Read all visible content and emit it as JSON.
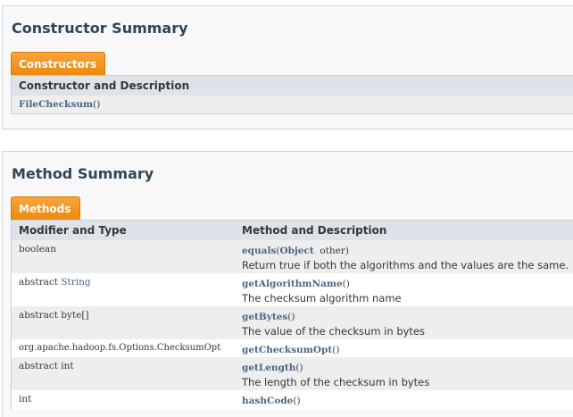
{
  "constructor_summary": {
    "title": "Constructor Summary",
    "tab": "Constructors",
    "header": "Constructor and Description",
    "rows": [
      {
        "name": "FileChecksum",
        "params": "()"
      }
    ]
  },
  "method_summary": {
    "title": "Method Summary",
    "tab": "Methods",
    "headers": {
      "col1": "Modifier and Type",
      "col2": "Method and Description"
    },
    "rows": [
      {
        "modifier": "boolean",
        "modifier_type": "",
        "method": "equals",
        "sig_open": "(",
        "param_type": "Object",
        "param_rest": "  other)",
        "desc": "Return true if both the algorithms and the values are the same."
      },
      {
        "modifier": "abstract ",
        "modifier_type": "String",
        "method": "getAlgorithmName",
        "sig_open": "()",
        "param_type": "",
        "param_rest": "",
        "desc": "The checksum algorithm name"
      },
      {
        "modifier": "abstract byte[]",
        "modifier_type": "",
        "method": "getBytes",
        "sig_open": "()",
        "param_type": "",
        "param_rest": "",
        "desc": "The value of the checksum in bytes"
      },
      {
        "modifier": "org.apache.hadoop.fs.Options.ChecksumOpt",
        "modifier_type": "",
        "method": "getChecksumOpt",
        "sig_open": "()",
        "param_type": "",
        "param_rest": "",
        "desc": ""
      },
      {
        "modifier": "abstract int",
        "modifier_type": "",
        "method": "getLength",
        "sig_open": "()",
        "param_type": "",
        "param_rest": "",
        "desc": "The length of the checksum in bytes"
      },
      {
        "modifier": "int",
        "modifier_type": "",
        "method": "hashCode",
        "sig_open": "()",
        "param_type": "",
        "param_rest": "",
        "desc": ""
      }
    ]
  }
}
